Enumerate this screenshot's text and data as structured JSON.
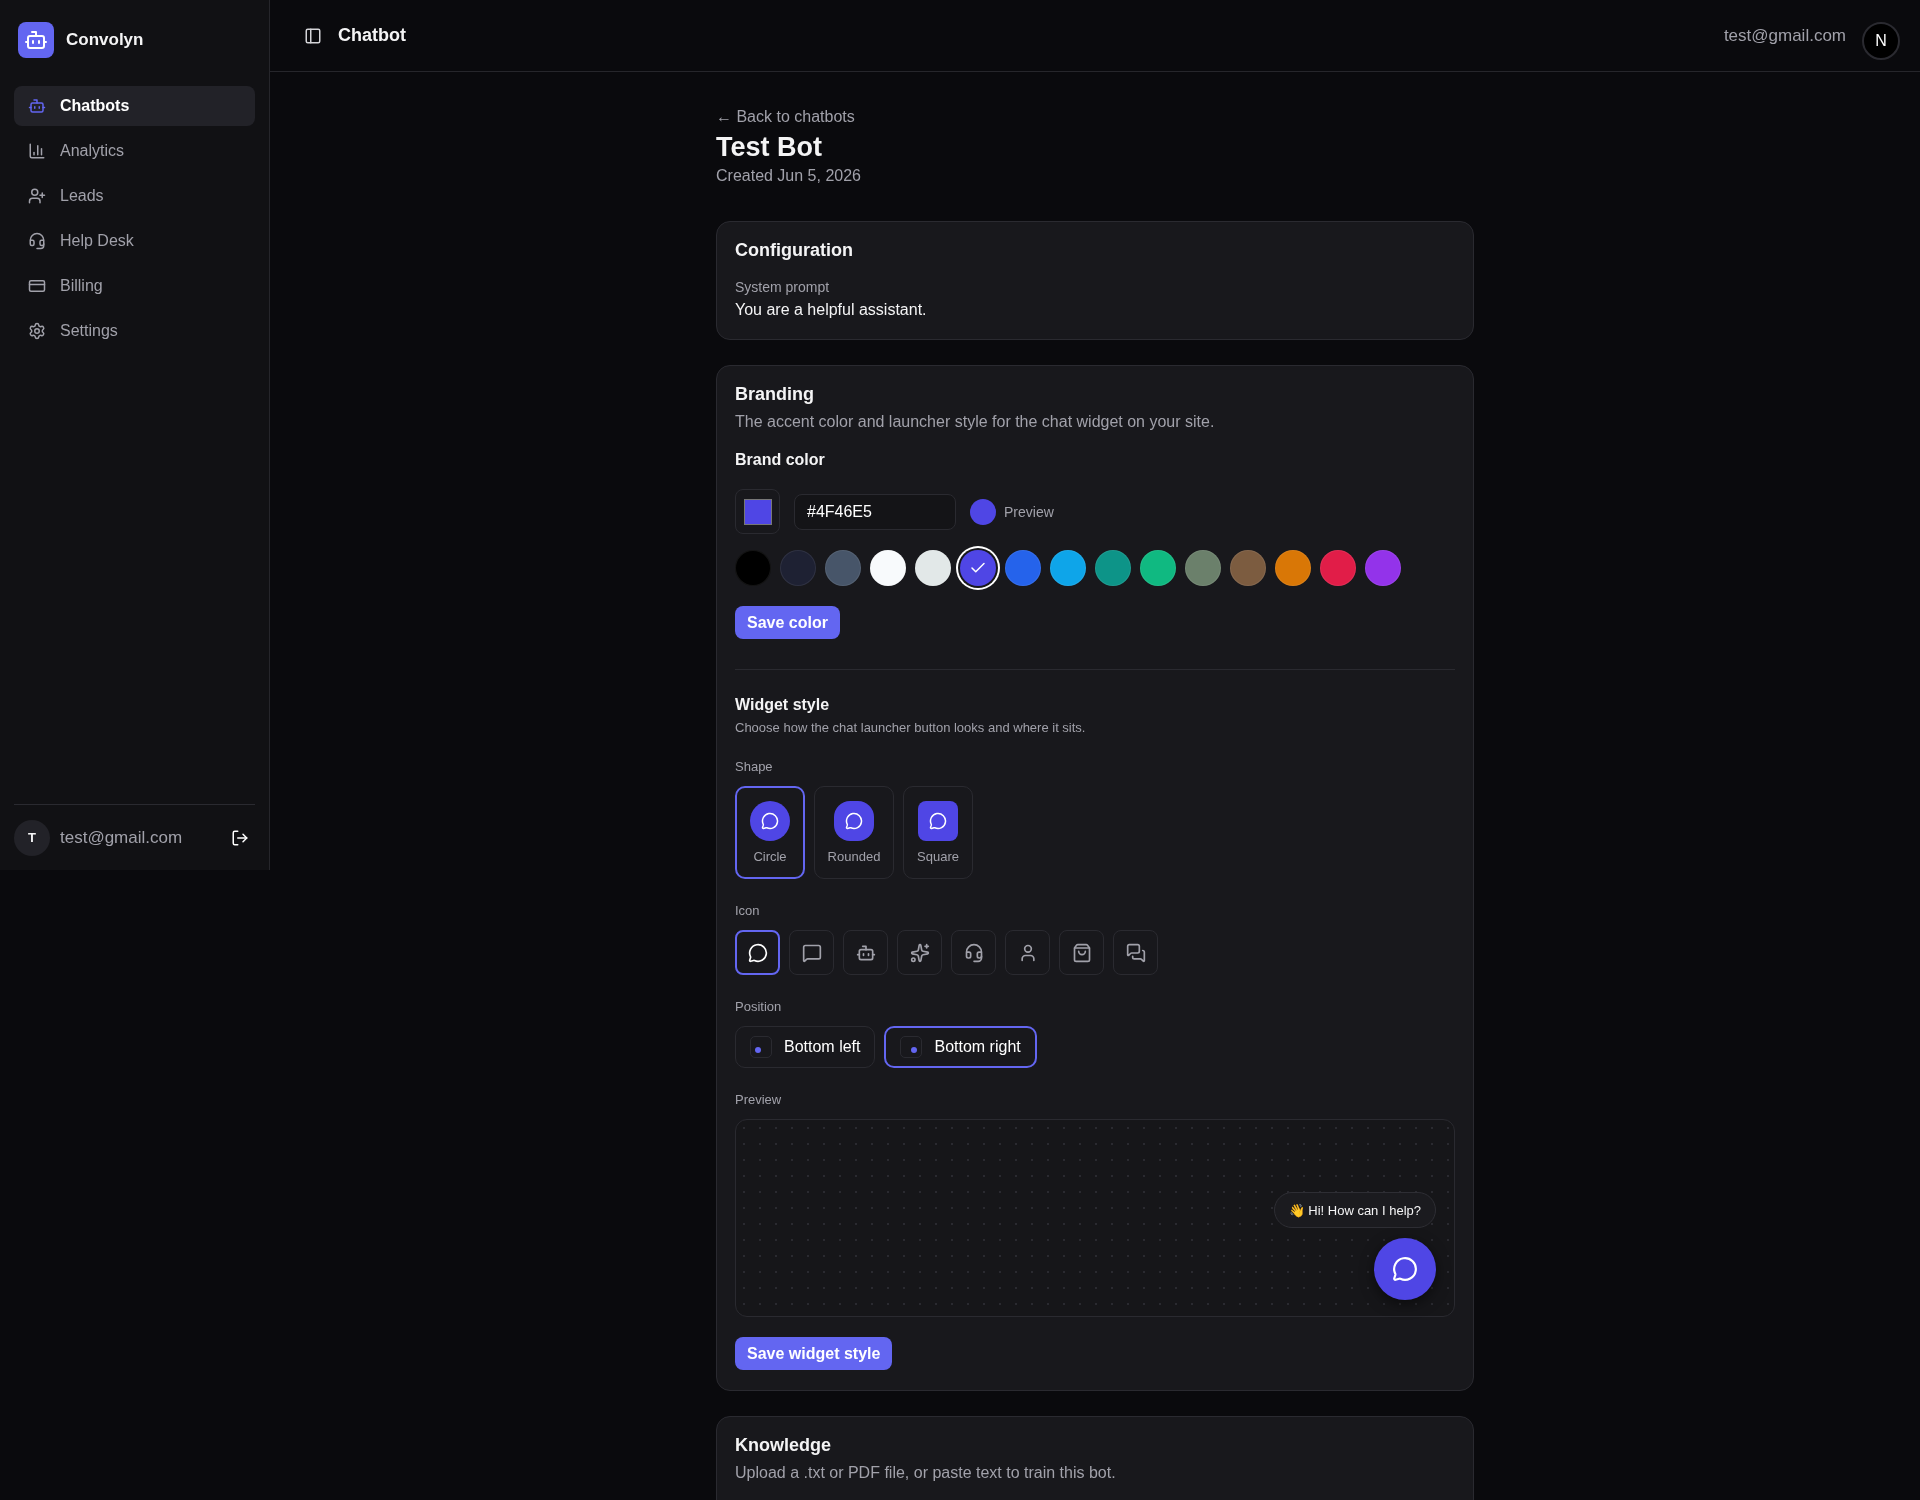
{
  "sidebar": {
    "brand": "Convolyn",
    "items": [
      {
        "label": "Chatbots",
        "kind": "bot",
        "selected": true
      },
      {
        "label": "Analytics",
        "kind": "chart",
        "selected": false
      },
      {
        "label": "Leads",
        "kind": "user-plus",
        "selected": false
      },
      {
        "label": "Help Desk",
        "kind": "headset",
        "selected": false
      },
      {
        "label": "Billing",
        "kind": "card",
        "selected": false
      },
      {
        "label": "Settings",
        "kind": "gear",
        "selected": false
      }
    ],
    "user": {
      "initial": "T",
      "email": "test@gmail.com"
    }
  },
  "header": {
    "title": "Chatbot",
    "email": "test@gmail.com",
    "avatar": "N"
  },
  "page": {
    "back": "← Back to chatbots",
    "title": "Test Bot",
    "created": "Created Jun 5, 2026"
  },
  "configuration": {
    "title": "Configuration",
    "label": "System prompt",
    "value": "You are a helpful assistant."
  },
  "branding": {
    "title": "Branding",
    "description": "The accent color and launcher style for the chat widget on your site.",
    "brand_color_label": "Brand color",
    "hex_value": "#4F46E5",
    "color": "#4f46e5",
    "preview_label": "Preview",
    "swatches": [
      {
        "color": "#000000",
        "selected": false
      },
      {
        "color": "#1e2133",
        "selected": false
      },
      {
        "color": "#475569",
        "selected": false
      },
      {
        "color": "#f8fafc",
        "selected": false
      },
      {
        "color": "#e2e8e8",
        "selected": false
      },
      {
        "color": "#4f46e5",
        "selected": true
      },
      {
        "color": "#2563eb",
        "selected": false
      },
      {
        "color": "#0ea5e9",
        "selected": false
      },
      {
        "color": "#0d9488",
        "selected": false
      },
      {
        "color": "#10b981",
        "selected": false
      },
      {
        "color": "#6b806b",
        "selected": false
      },
      {
        "color": "#7c5c40",
        "selected": false
      },
      {
        "color": "#d97706",
        "selected": false
      },
      {
        "color": "#e11d48",
        "selected": false
      },
      {
        "color": "#9333ea",
        "selected": false
      }
    ],
    "save_color": "Save color"
  },
  "widget_style": {
    "title": "Widget style",
    "description": "Choose how the chat launcher button looks and where it sits.",
    "shape_label": "Shape",
    "shapes": [
      {
        "label": "Circle",
        "kind": "circle",
        "selected": true
      },
      {
        "label": "Rounded",
        "kind": "rounded",
        "selected": false
      },
      {
        "label": "Square",
        "kind": "square",
        "selected": false
      }
    ],
    "icon_label": "Icon",
    "icons": [
      {
        "kind": "chat-circle",
        "selected": true
      },
      {
        "kind": "chat-square",
        "selected": false
      },
      {
        "kind": "bot",
        "selected": false
      },
      {
        "kind": "sparkles",
        "selected": false
      },
      {
        "kind": "headset",
        "selected": false
      },
      {
        "kind": "user",
        "selected": false
      },
      {
        "kind": "bag",
        "selected": false
      },
      {
        "kind": "chats",
        "selected": false
      }
    ],
    "position_label": "Position",
    "positions": [
      {
        "label": "Bottom left",
        "kind": "left",
        "selected": false
      },
      {
        "label": "Bottom right",
        "kind": "right",
        "selected": true
      }
    ],
    "preview_label": "Preview",
    "greeting": "👋 Hi! How can I help?",
    "save": "Save widget style"
  },
  "knowledge": {
    "title": "Knowledge",
    "description": "Upload a .txt or PDF file, or paste text to train this bot."
  }
}
